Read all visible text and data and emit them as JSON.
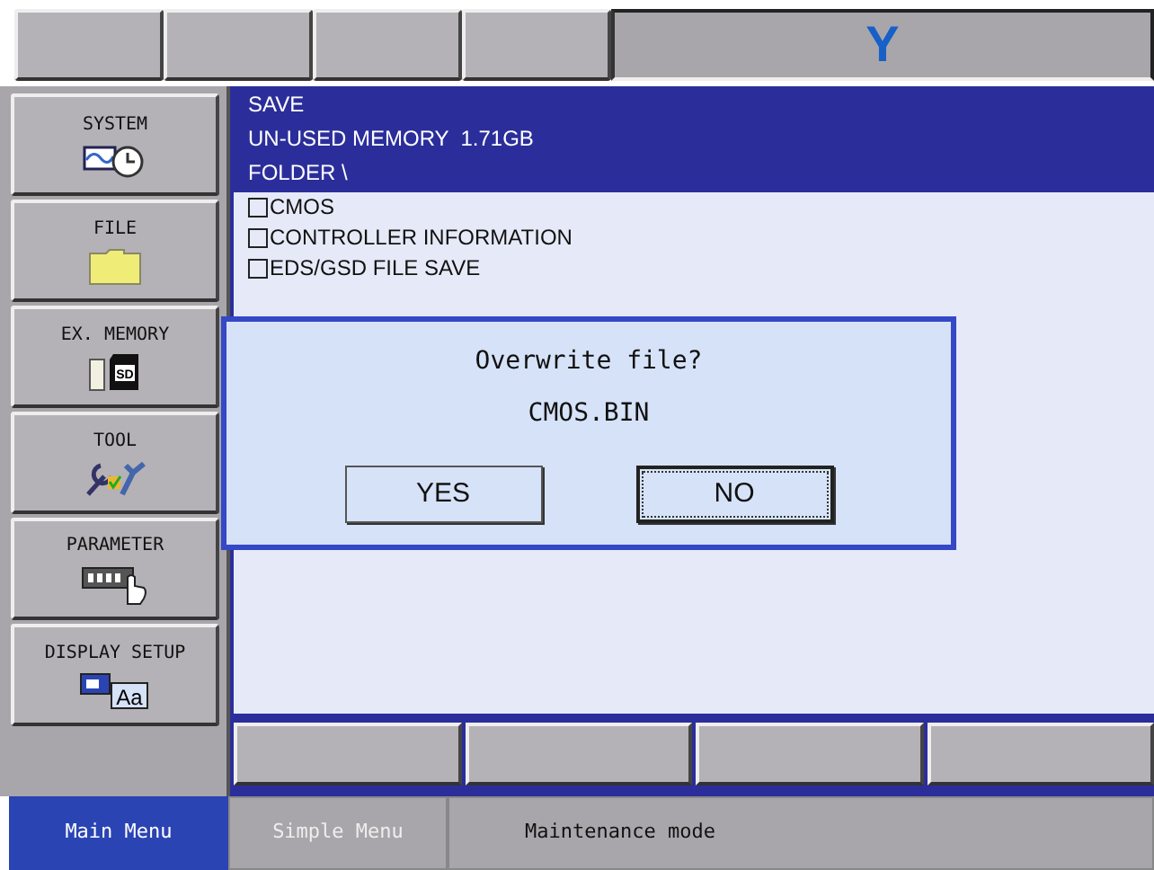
{
  "logo": "Y",
  "sidebar": {
    "items": [
      {
        "label": "SYSTEM",
        "kind": "system"
      },
      {
        "label": "FILE",
        "kind": "file"
      },
      {
        "label": "EX. MEMORY",
        "kind": "memory",
        "icon_text": "SD"
      },
      {
        "label": "TOOL",
        "kind": "tool"
      },
      {
        "label": "PARAMETER",
        "kind": "parameter"
      },
      {
        "label": "DISPLAY SETUP",
        "kind": "display",
        "icon_text": "Aa"
      }
    ]
  },
  "content": {
    "header_lines": [
      "SAVE",
      "UN-USED MEMORY  1.71GB",
      "FOLDER \\"
    ],
    "items": [
      {
        "label": "CMOS",
        "checked": false
      },
      {
        "label": "CONTROLLER INFORMATION",
        "checked": false
      },
      {
        "label": "EDS/GSD FILE SAVE",
        "checked": false
      }
    ]
  },
  "dialog": {
    "message": "Overwrite file?",
    "filename": "CMOS.BIN",
    "buttons": [
      {
        "label": "YES",
        "selected": false
      },
      {
        "label": "NO",
        "selected": true
      }
    ]
  },
  "bottom_tabs": [
    {
      "label": "Main Menu",
      "selected": true
    },
    {
      "label": "Simple Menu",
      "selected": false
    }
  ],
  "status": "Maintenance mode"
}
